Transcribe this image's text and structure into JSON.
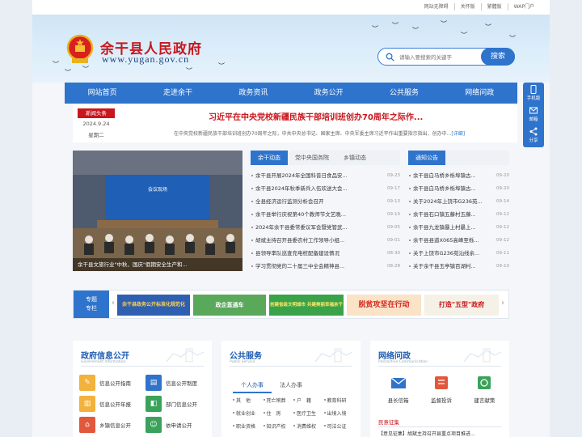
{
  "toplinks": [
    "网站无障碍",
    "关怀版",
    "繁體版",
    "WAP门户"
  ],
  "header": {
    "title": "余干县人民政府",
    "url": "www.yugan.gov.cn",
    "search_placeholder": "请输入要搜索的关键字",
    "search_button": "搜索"
  },
  "nav": [
    "网站首页",
    "走进余干",
    "政务资讯",
    "政务公开",
    "公共服务",
    "网络问政"
  ],
  "side": [
    "手机版",
    "邮箱",
    "分享"
  ],
  "headline": {
    "tag": "新闻头条",
    "date": "2024.9.24",
    "weekday": "星期二",
    "title": "习近平在中央党校新疆民族干部培训班创办70周年之际作...",
    "desc": "在中央党校新疆民族干部培训班创办70周年之际，中共中央总书记、国家主席、中央军委主席习近平作出重要指示指出，创办中...",
    "more": "[详细]"
  },
  "photo_caption": "余干县文旅行业\"中秋、国庆\"假期安全生产和...",
  "news": {
    "tabs": [
      "余干动态",
      "党中央国务院",
      "乡镇动态"
    ],
    "items": [
      {
        "t": "余干县开展2024年全国科普日食品安...",
        "d": "09-23"
      },
      {
        "t": "余干县2024年秋季新兵入伍欢送大会...",
        "d": "09-17"
      },
      {
        "t": "全县经济运行监测分析会召开",
        "d": "09-13"
      },
      {
        "t": "余干县举行庆祝第40个教师节文艺晚...",
        "d": "09-10"
      },
      {
        "t": "2024年余干县委常委议军会暨党管武...",
        "d": "09-05"
      },
      {
        "t": "胡斌主持召开县委农村工作领导小组...",
        "d": "09-01"
      },
      {
        "t": "县领导率队巡查充电桩配备建设情况",
        "d": "08-30"
      },
      {
        "t": "学习贯彻党的二十届三中全会精神县...",
        "d": "08-28"
      }
    ]
  },
  "notice": {
    "tab": "通知公告",
    "items": [
      {
        "t": "余干县白马桥乡栎埠镇古...",
        "d": "09-20"
      },
      {
        "t": "余干县白马桥乡栎埠镇古...",
        "d": "09-20"
      },
      {
        "t": "关于2024年上饶市G236苑...",
        "d": "09-14"
      },
      {
        "t": "余干县石口镇五藤村五藤...",
        "d": "09-12"
      },
      {
        "t": "余干县九龙镇暴上村暴上...",
        "d": "09-12"
      },
      {
        "t": "余干县县道X065高峰至栎...",
        "d": "09-12"
      },
      {
        "t": "关于上饶市G236苑汕线余...",
        "d": "09-11"
      },
      {
        "t": "关于余干县玉亭镇百湖村...",
        "d": "09-10"
      }
    ]
  },
  "topic": {
    "label1": "专题",
    "label2": "专栏",
    "banners": [
      "余干县政务公开标准化规范化",
      "政企直通车",
      "创建省级文明城市 共建美丽幸福余干",
      "脱贫攻坚在行动",
      "打造\"五型\"政府"
    ]
  },
  "panels": {
    "info": {
      "title": "政府信息公开",
      "sub": "Government Information",
      "items": [
        "信息公开指南",
        "信息公开制度",
        "信息公开年报",
        "部门信息公开",
        "乡镇信息公开",
        "依申请公开"
      ]
    },
    "service": {
      "title": "公共服务",
      "sub": "Public Service",
      "tabs": [
        "个人办事",
        "法人办事"
      ],
      "items": [
        "其　他",
        "死亡殡葬",
        "户　籍",
        "教育科研",
        "就业创业",
        "住　房",
        "医疗卫生",
        "出境入境",
        "职业资格",
        "知识产权",
        "消费维权",
        "司法公证"
      ]
    },
    "interact": {
      "title": "网络问政",
      "sub": "Interactive Communication",
      "items": [
        "县长信箱",
        "监督投诉",
        "建言献策"
      ],
      "section": "民意征集",
      "first_item": "【意见征集】胡斌主持召开县重点项目推进..."
    }
  },
  "colors": {
    "brand": "#2f74cc",
    "red": "#c8161d"
  }
}
